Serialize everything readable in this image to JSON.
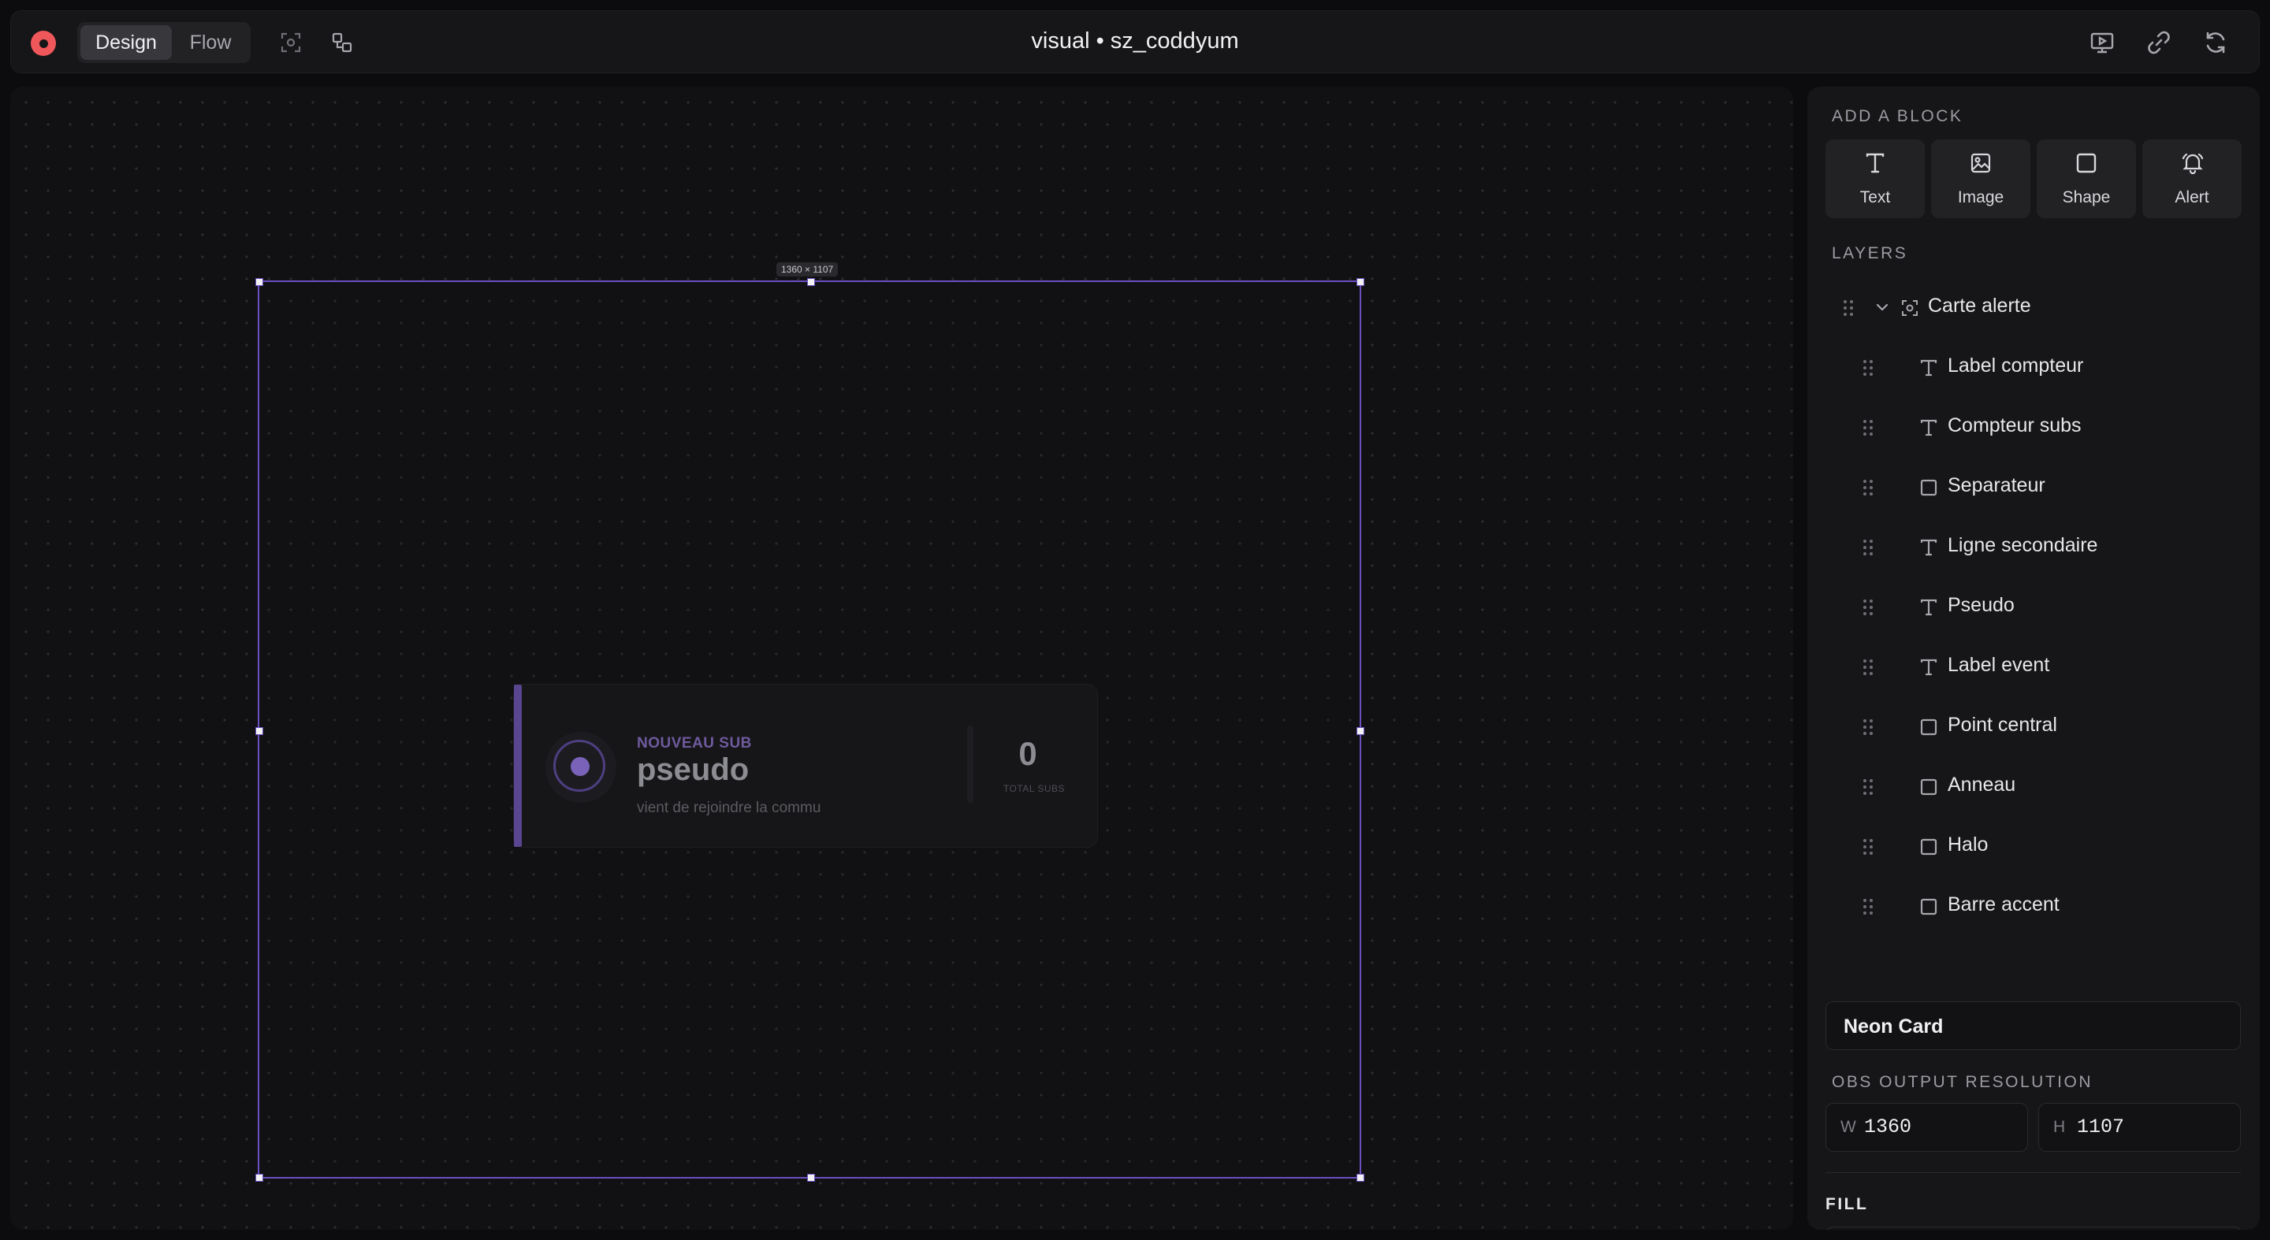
{
  "topbar": {
    "modes": [
      "Design",
      "Flow"
    ],
    "active_mode": "Design",
    "title": "visual • sz_coddyum",
    "icons": [
      "focus-icon",
      "layout-icon",
      "preview-icon",
      "link-icon",
      "refresh-icon"
    ]
  },
  "canvas": {
    "frame_size_label": "1360 × 1107",
    "card": {
      "label_event": "NOUVEAU SUB",
      "pseudo": "pseudo",
      "secondary_line": "vient de rejoindre la commu",
      "counter": "0",
      "counter_label": "TOTAL SUBS"
    }
  },
  "panel": {
    "add_block_title": "ADD A BLOCK",
    "blocks": [
      "Text",
      "Image",
      "Shape",
      "Alert"
    ],
    "layers_title": "LAYERS",
    "group": "Carte alerte",
    "layers": [
      {
        "name": "Label compteur",
        "kind": "text"
      },
      {
        "name": "Compteur subs",
        "kind": "text"
      },
      {
        "name": "Separateur",
        "kind": "shape"
      },
      {
        "name": "Ligne secondaire",
        "kind": "text"
      },
      {
        "name": "Pseudo",
        "kind": "text"
      },
      {
        "name": "Label event",
        "kind": "text"
      },
      {
        "name": "Point central",
        "kind": "shape"
      },
      {
        "name": "Anneau",
        "kind": "shape"
      },
      {
        "name": "Halo",
        "kind": "shape"
      },
      {
        "name": "Barre accent",
        "kind": "shape"
      }
    ],
    "component_name": "Neon Card",
    "resolution_title": "OBS OUTPUT RESOLUTION",
    "width_label": "W",
    "width_value": "1360",
    "height_label": "H",
    "height_value": "1107",
    "fill_title": "FILL"
  },
  "colors": {
    "accent": "#6c4fc2",
    "record": "#f0575b",
    "background": "#0c0c0e",
    "panel": "#161618"
  }
}
